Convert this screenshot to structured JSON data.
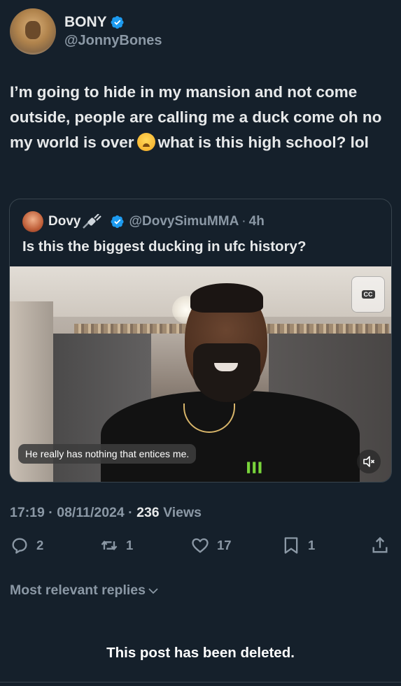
{
  "author": {
    "display_name": "BONY",
    "handle": "@JonnyBones",
    "verified": true,
    "avatar_icon": "lion-costume-avatar"
  },
  "tweet": {
    "text_before_emoji": "I’m going to hide in my mansion and not come outside, people are calling me a duck come oh no my world is over",
    "emoji": "weary-face-emoji",
    "text_after_emoji": "what is this high school? lol"
  },
  "quote": {
    "display_name": "Dovy",
    "name_icon": "plug-icon",
    "verified": true,
    "handle": "@DovySimuMMA",
    "separator": "·",
    "time": "4h",
    "text": "Is this the biggest ducking in ufc history?",
    "video": {
      "caption": "He really has nothing that entices me.",
      "watermark_icon": "cc-icon",
      "watermark_text": "CC",
      "mute_icon": "mute-icon"
    }
  },
  "meta": {
    "time": "17:19",
    "sep1": "·",
    "date": "08/11/2024",
    "sep2": "·",
    "views_count": "236",
    "views_label": "Views"
  },
  "actions": {
    "replies": "2",
    "reposts": "1",
    "likes": "17",
    "bookmarks": "1"
  },
  "replies_sort": {
    "label": "Most relevant replies"
  },
  "deleted_notice": "This post has been deleted.",
  "colors": {
    "background": "#15202b",
    "text_primary": "#e7e9ea",
    "text_secondary": "#8b98a5",
    "verified_blue": "#1d9bf0",
    "border": "#38444d"
  }
}
